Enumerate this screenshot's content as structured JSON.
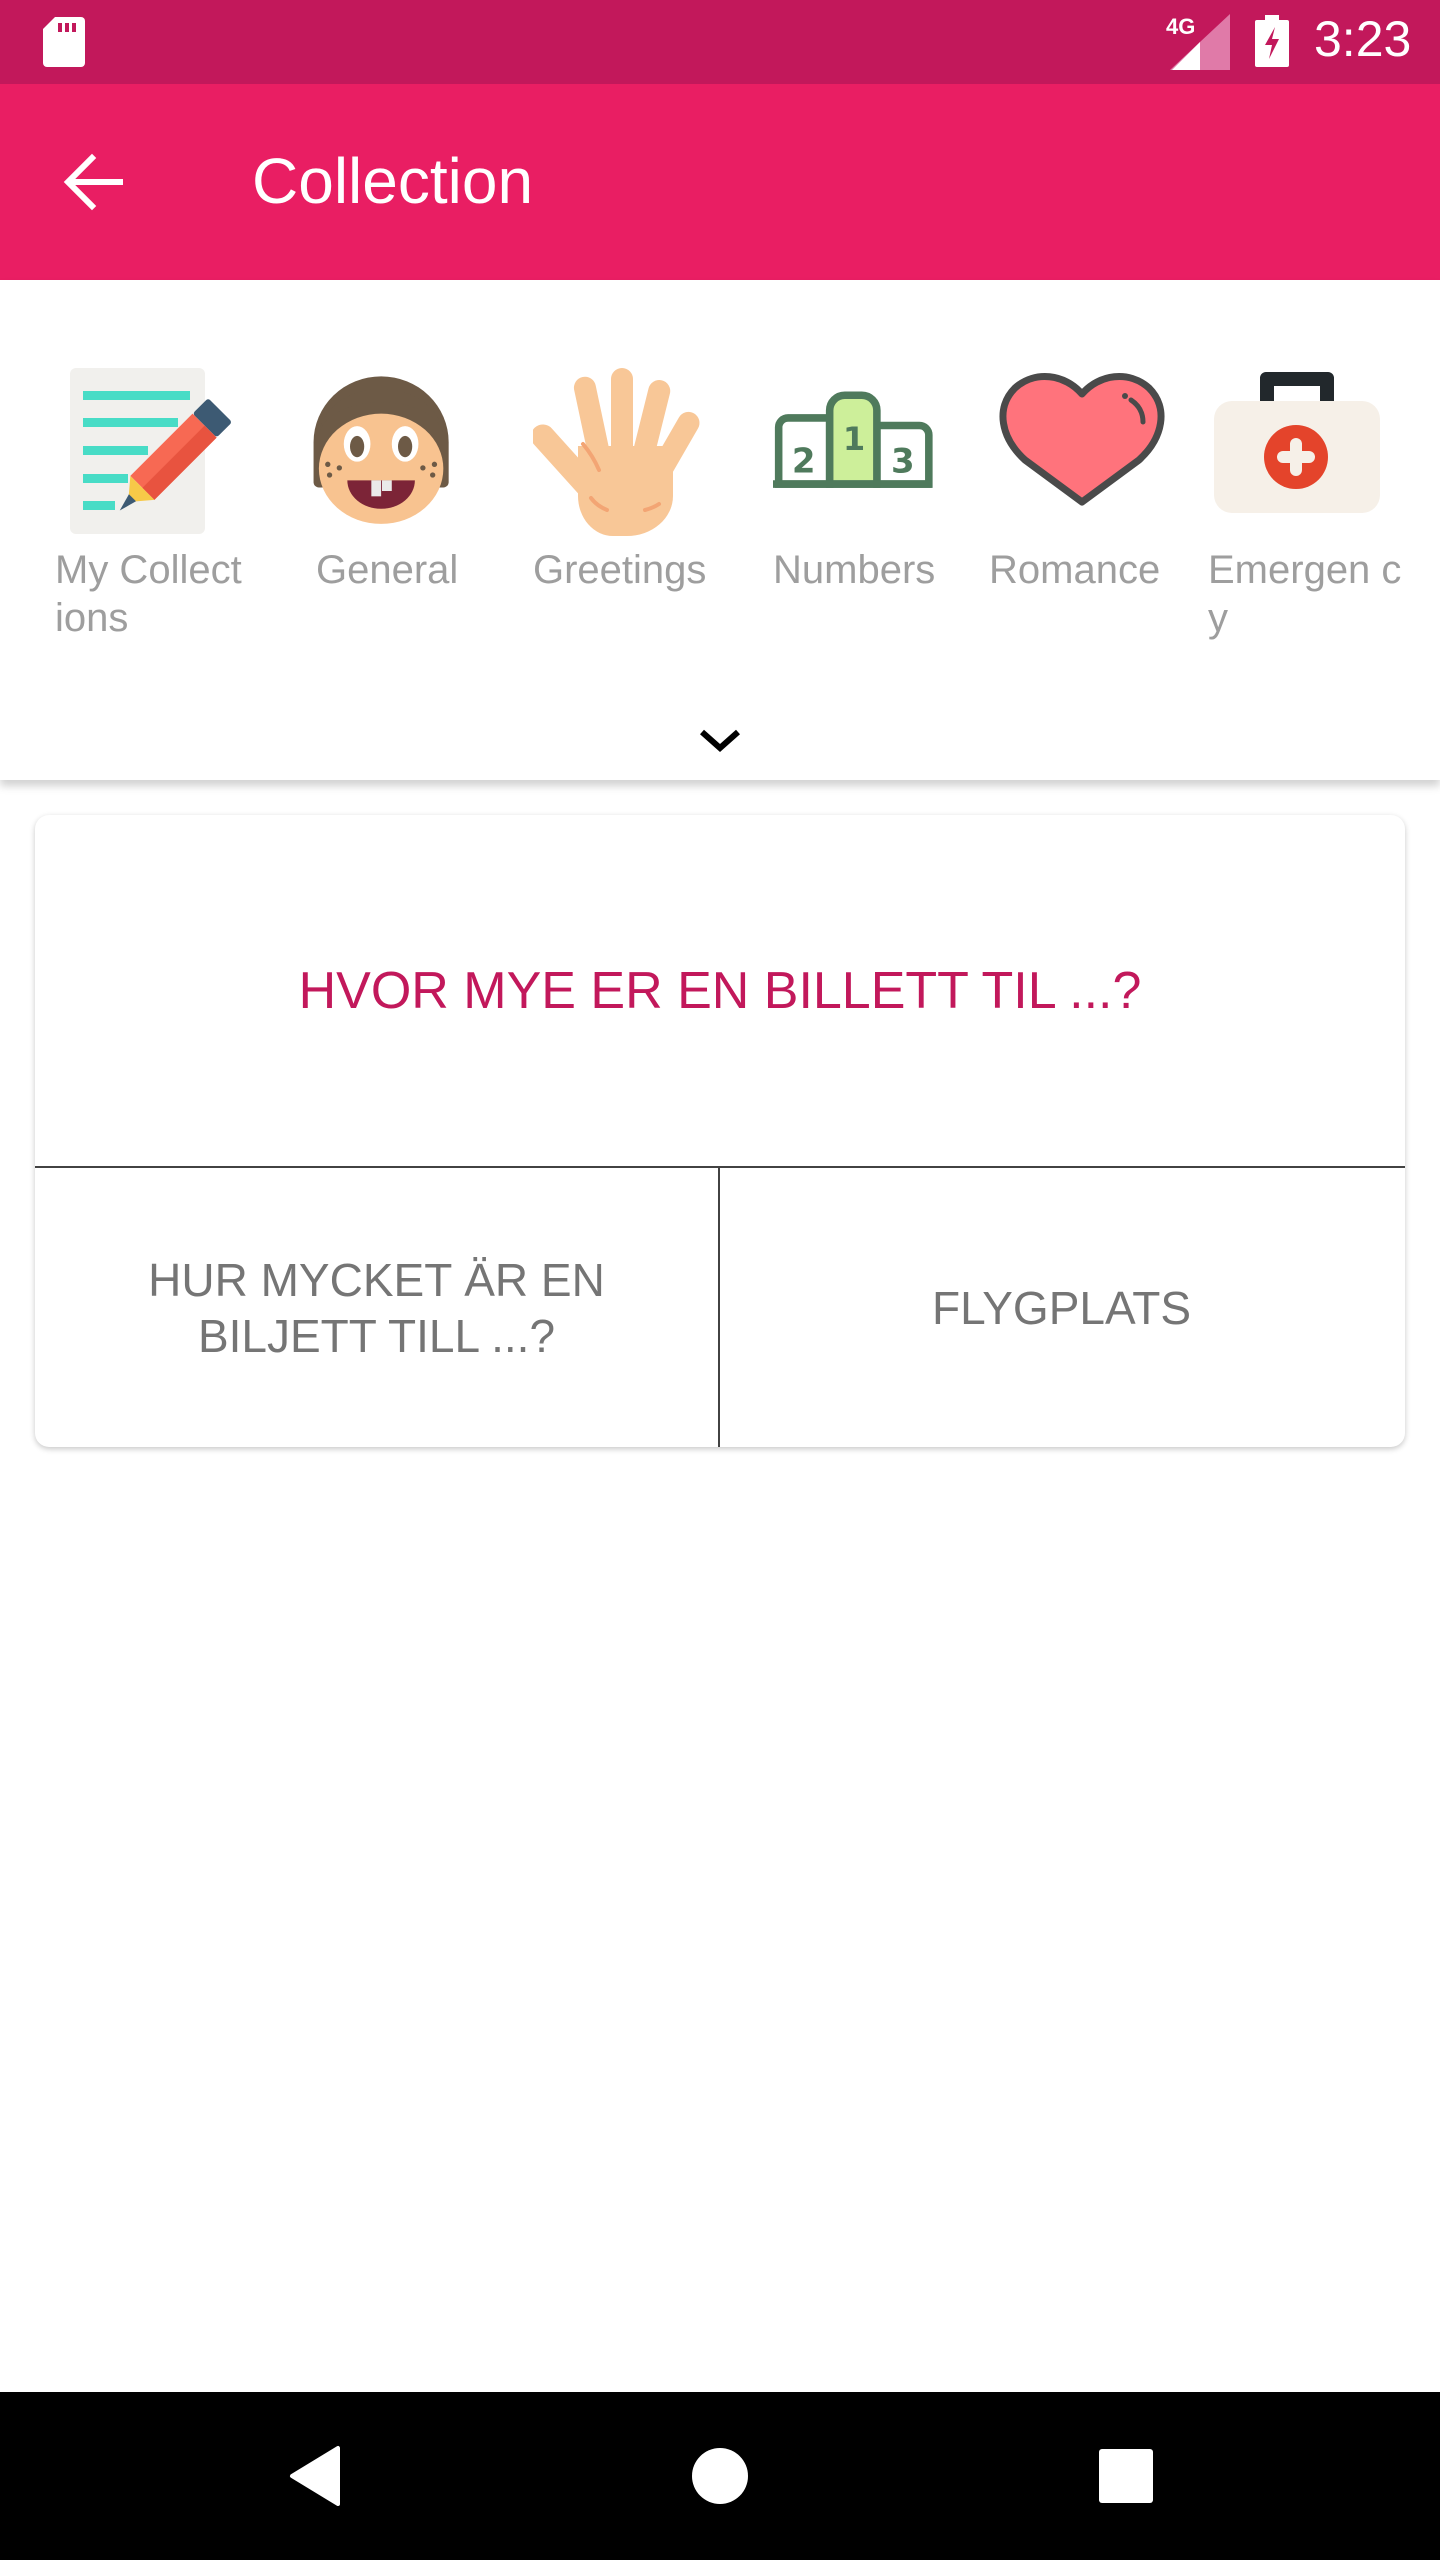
{
  "status_bar": {
    "network_type": "4G",
    "time": "3:23",
    "icons": [
      "sd-card-icon",
      "signal-icon",
      "battery-charging-icon"
    ]
  },
  "app_bar": {
    "title": "Collection",
    "back_icon": "arrow-back-icon"
  },
  "categories": [
    {
      "label": "My Collections",
      "display_label": "My Collect ions",
      "icon": "notes-pencil-icon"
    },
    {
      "label": "General",
      "display_label": "General",
      "icon": "face-icon"
    },
    {
      "label": "Greetings",
      "display_label": "Greetings",
      "icon": "hand-icon"
    },
    {
      "label": "Numbers",
      "display_label": "Numbers",
      "icon": "podium-icon"
    },
    {
      "label": "Romance",
      "display_label": "Romance",
      "icon": "heart-icon"
    },
    {
      "label": "Emergency",
      "display_label": "Emergen cy",
      "icon": "first-aid-kit-icon"
    }
  ],
  "expand_icon": "chevron-down-icon",
  "phrase_card": {
    "source_text": "HVOR MYE ER EN BILLETT TIL ...?",
    "translation_text": "HUR MYCKET ÄR EN BILJETT TILL ...?",
    "related_word": "FLYGPLATS"
  },
  "colors": {
    "status_bar": "#c2185b",
    "app_bar": "#e91e63",
    "source_text": "#c2185b",
    "category_label": "#9e9e9e",
    "cell_text": "#757575"
  },
  "nav_bar": {
    "buttons": [
      "back",
      "home",
      "recents"
    ]
  }
}
